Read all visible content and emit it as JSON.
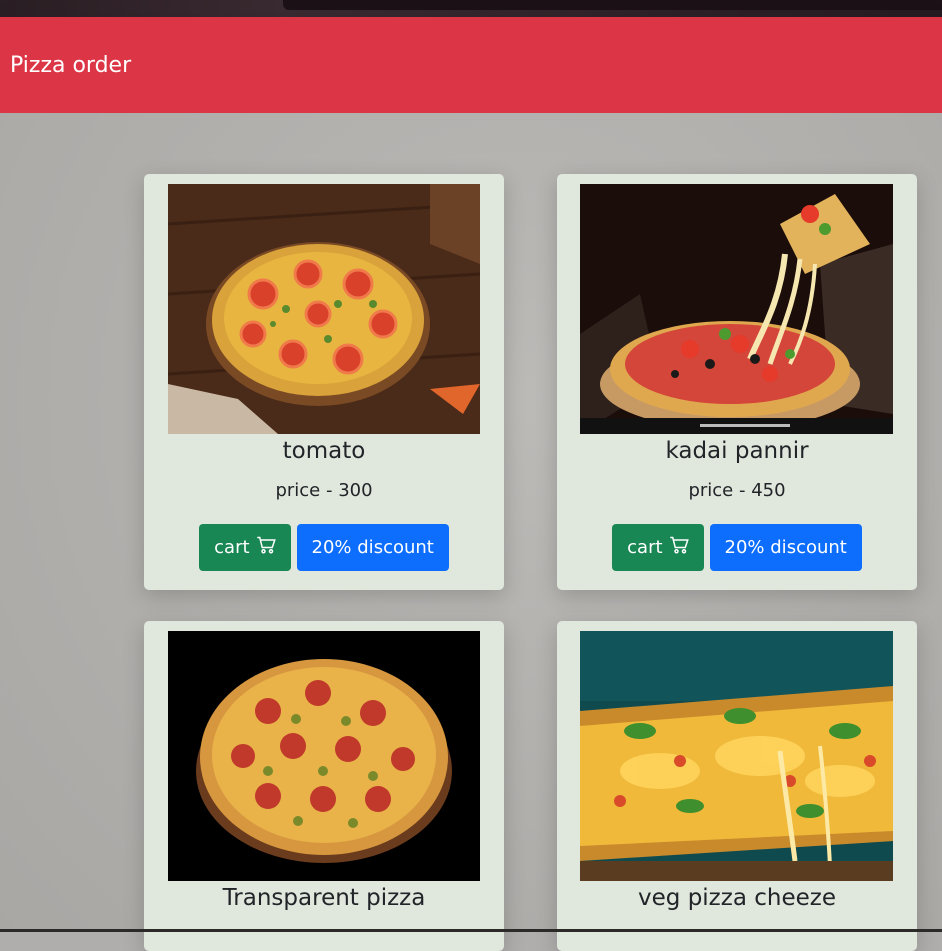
{
  "navbar": {
    "brand": "Pizza order"
  },
  "products": [
    {
      "name": "tomato",
      "price": "price - 300",
      "cart_label": "cart",
      "discount_label": "20% discount",
      "image": "tomato-pizza-photo"
    },
    {
      "name": "kadai pannir",
      "price": "price - 450",
      "cart_label": "cart",
      "discount_label": "20% discount",
      "image": "kadai-pannir-pizza-photo"
    },
    {
      "name": "Transparent pizza",
      "image": "pepperoni-pizza-photo"
    },
    {
      "name": "veg pizza cheeze",
      "image": "veg-cheese-pizza-photo"
    }
  ],
  "colors": {
    "navbar": "#dc3545",
    "card": "#e0e7dc",
    "cart_button": "#198754",
    "discount_button": "#0d6efd"
  },
  "icons": {
    "cart": "cart-icon"
  }
}
